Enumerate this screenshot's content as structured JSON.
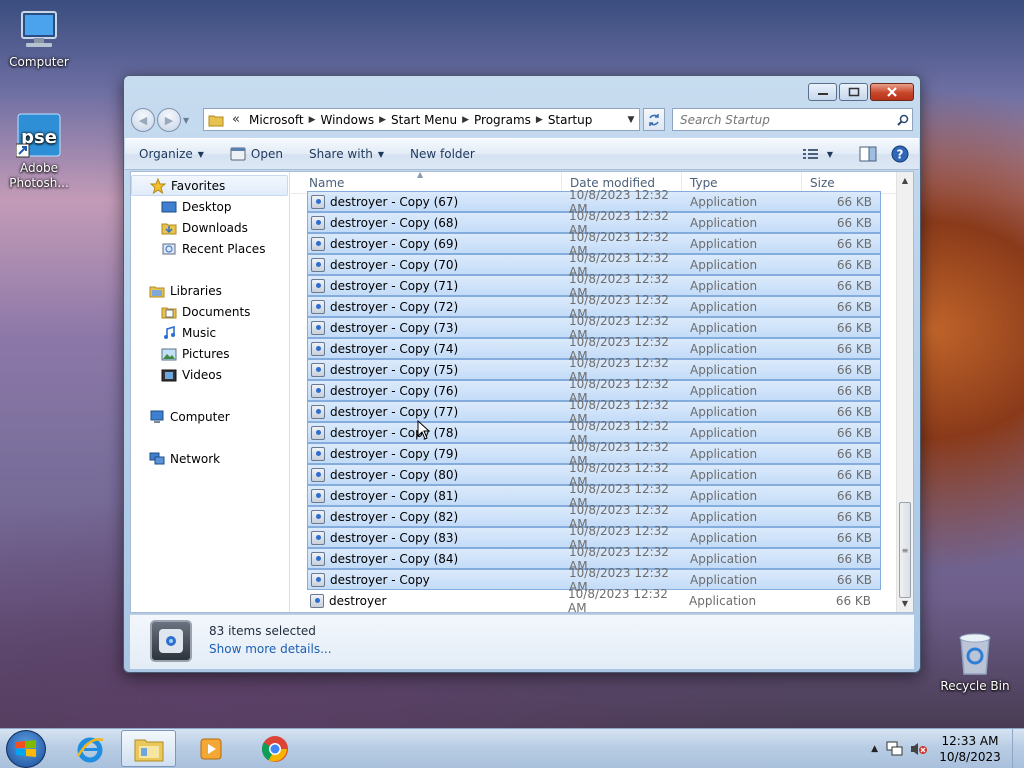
{
  "desktop": {
    "icons": [
      {
        "label": "Computer"
      },
      {
        "label": "Adobe Photosh..."
      },
      {
        "label": "Recycle Bin"
      }
    ]
  },
  "explorer": {
    "address": {
      "prefix": "«",
      "crumbs": [
        "Microsoft",
        "Windows",
        "Start Menu",
        "Programs",
        "Startup"
      ]
    },
    "search": {
      "placeholder": "Search Startup"
    },
    "toolbar": {
      "organize": "Organize",
      "open": "Open",
      "share_with": "Share with",
      "new_folder": "New folder"
    },
    "nav": {
      "favorites": "Favorites",
      "desktop": "Desktop",
      "downloads": "Downloads",
      "recent_places": "Recent Places",
      "libraries": "Libraries",
      "documents": "Documents",
      "music": "Music",
      "pictures": "Pictures",
      "videos": "Videos",
      "computer": "Computer",
      "network": "Network"
    },
    "columns": {
      "name": "Name",
      "date": "Date modified",
      "type": "Type",
      "size": "Size"
    },
    "files": [
      {
        "name": "destroyer - Copy (67)",
        "date": "10/8/2023 12:32 AM",
        "type": "Application",
        "size": "66 KB",
        "selected": true
      },
      {
        "name": "destroyer - Copy (68)",
        "date": "10/8/2023 12:32 AM",
        "type": "Application",
        "size": "66 KB",
        "selected": true
      },
      {
        "name": "destroyer - Copy (69)",
        "date": "10/8/2023 12:32 AM",
        "type": "Application",
        "size": "66 KB",
        "selected": true
      },
      {
        "name": "destroyer - Copy (70)",
        "date": "10/8/2023 12:32 AM",
        "type": "Application",
        "size": "66 KB",
        "selected": true
      },
      {
        "name": "destroyer - Copy (71)",
        "date": "10/8/2023 12:32 AM",
        "type": "Application",
        "size": "66 KB",
        "selected": true
      },
      {
        "name": "destroyer - Copy (72)",
        "date": "10/8/2023 12:32 AM",
        "type": "Application",
        "size": "66 KB",
        "selected": true
      },
      {
        "name": "destroyer - Copy (73)",
        "date": "10/8/2023 12:32 AM",
        "type": "Application",
        "size": "66 KB",
        "selected": true
      },
      {
        "name": "destroyer - Copy (74)",
        "date": "10/8/2023 12:32 AM",
        "type": "Application",
        "size": "66 KB",
        "selected": true
      },
      {
        "name": "destroyer - Copy (75)",
        "date": "10/8/2023 12:32 AM",
        "type": "Application",
        "size": "66 KB",
        "selected": true
      },
      {
        "name": "destroyer - Copy (76)",
        "date": "10/8/2023 12:32 AM",
        "type": "Application",
        "size": "66 KB",
        "selected": true
      },
      {
        "name": "destroyer - Copy (77)",
        "date": "10/8/2023 12:32 AM",
        "type": "Application",
        "size": "66 KB",
        "selected": true
      },
      {
        "name": "destroyer - Copy (78)",
        "date": "10/8/2023 12:32 AM",
        "type": "Application",
        "size": "66 KB",
        "selected": true
      },
      {
        "name": "destroyer - Copy (79)",
        "date": "10/8/2023 12:32 AM",
        "type": "Application",
        "size": "66 KB",
        "selected": true
      },
      {
        "name": "destroyer - Copy (80)",
        "date": "10/8/2023 12:32 AM",
        "type": "Application",
        "size": "66 KB",
        "selected": true
      },
      {
        "name": "destroyer - Copy (81)",
        "date": "10/8/2023 12:32 AM",
        "type": "Application",
        "size": "66 KB",
        "selected": true
      },
      {
        "name": "destroyer - Copy (82)",
        "date": "10/8/2023 12:32 AM",
        "type": "Application",
        "size": "66 KB",
        "selected": true
      },
      {
        "name": "destroyer - Copy (83)",
        "date": "10/8/2023 12:32 AM",
        "type": "Application",
        "size": "66 KB",
        "selected": true
      },
      {
        "name": "destroyer - Copy (84)",
        "date": "10/8/2023 12:32 AM",
        "type": "Application",
        "size": "66 KB",
        "selected": true
      },
      {
        "name": "destroyer - Copy",
        "date": "10/8/2023 12:32 AM",
        "type": "Application",
        "size": "66 KB",
        "selected": true
      },
      {
        "name": "destroyer",
        "date": "10/8/2023 12:32 AM",
        "type": "Application",
        "size": "66 KB",
        "selected": false
      }
    ],
    "details": {
      "count": "83 items selected",
      "more": "Show more details..."
    }
  },
  "taskbar": {
    "apps": [
      "windows-explorer",
      "internet-explorer",
      "file-explorer",
      "media-player",
      "chrome"
    ],
    "clock": {
      "time": "12:33 AM",
      "date": "10/8/2023"
    }
  },
  "colors": {
    "selection": "#cce0f8",
    "selection_border": "#84acdd",
    "link": "#1a5fb4"
  }
}
